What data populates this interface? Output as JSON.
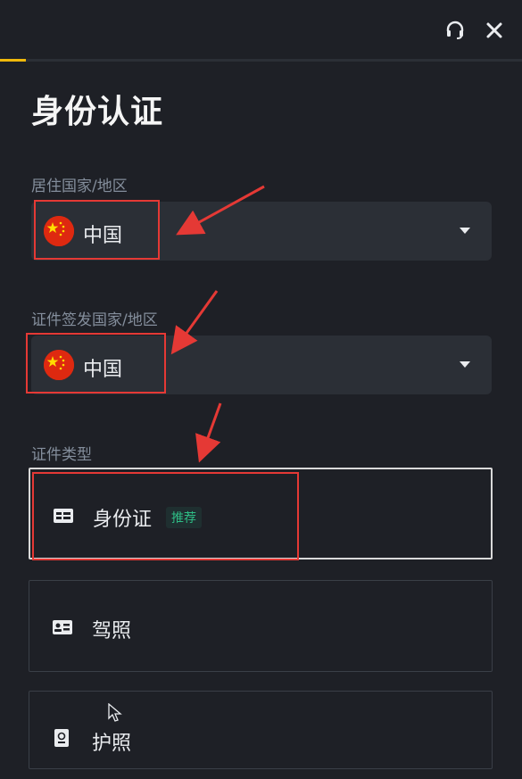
{
  "title": "身份认证",
  "progress": 0.05,
  "icons": {
    "support": "headset-icon",
    "close": "close-icon"
  },
  "residence": {
    "label": "居住国家/地区",
    "value": "中国",
    "flag": "china-flag-icon"
  },
  "issuing": {
    "label": "证件签发国家/地区",
    "value": "中国",
    "flag": "china-flag-icon"
  },
  "doc_type": {
    "label": "证件类型",
    "options": [
      {
        "label": "身份证",
        "badge": "推荐",
        "icon": "id-card-icon",
        "selected": true
      },
      {
        "label": "驾照",
        "icon": "driver-license-icon",
        "selected": false
      },
      {
        "label": "护照",
        "icon": "passport-icon",
        "selected": false
      }
    ]
  },
  "colors": {
    "background": "#1e2026",
    "accent": "#f0b90b",
    "field_bg": "#2b2f36",
    "badge_green": "#2ebd85",
    "annotation_red": "#e53935"
  }
}
